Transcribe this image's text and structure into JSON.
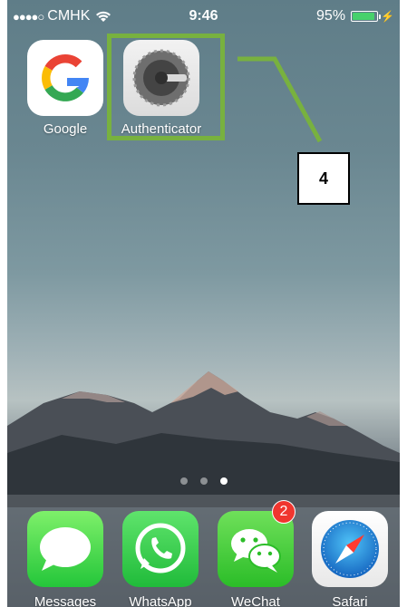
{
  "status_bar": {
    "signal_dots": "●●●●○",
    "carrier": "CMHK",
    "time": "9:46",
    "battery_percent": "95%",
    "battery_level": 0.95,
    "wifi_icon": "wifi-icon",
    "charging_icon": "bolt-icon"
  },
  "home_apps": [
    {
      "label": "Google",
      "icon": "google-g-icon"
    },
    {
      "label": "Authenticator",
      "icon": "authenticator-icon"
    }
  ],
  "annotation": {
    "step_number": "4",
    "highlight_color": "#78b13f"
  },
  "page_indicator": {
    "count": 3,
    "active_index": 2
  },
  "dock": [
    {
      "label": "Messages",
      "icon": "speech-bubble-icon"
    },
    {
      "label": "WhatsApp",
      "icon": "phone-bubble-icon"
    },
    {
      "label": "WeChat",
      "icon": "chat-bubbles-icon",
      "badge": "2"
    },
    {
      "label": "Safari",
      "icon": "compass-icon"
    }
  ]
}
